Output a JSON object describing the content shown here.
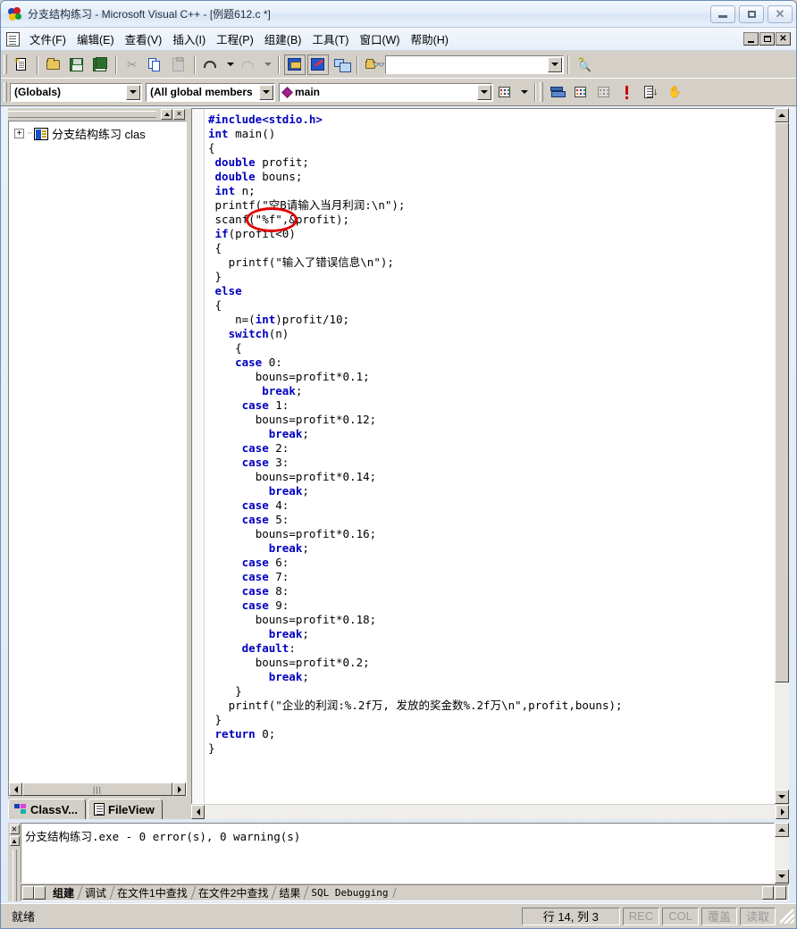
{
  "window": {
    "title": "分支结构练习 - Microsoft Visual C++ - [例题612.c *]",
    "minimize_label": "最小化",
    "maximize_label": "最大化",
    "close_label": "关闭"
  },
  "menu": {
    "items": [
      "文件(F)",
      "编辑(E)",
      "查看(V)",
      "插入(I)",
      "工程(P)",
      "组建(B)",
      "工具(T)",
      "窗口(W)",
      "帮助(H)"
    ],
    "mdi_minimize": "_",
    "mdi_restore": "",
    "mdi_close": "X"
  },
  "toolbar_standard": {
    "buttons": [
      {
        "name": "new-file",
        "icon": "new-document-icon"
      },
      {
        "name": "open-file",
        "icon": "open-folder-icon"
      },
      {
        "name": "save-file",
        "icon": "save-disk-icon"
      },
      {
        "name": "save-all",
        "icon": "save-all-disks-icon"
      },
      {
        "name": "cut",
        "icon": "scissors-icon"
      },
      {
        "name": "copy",
        "icon": "copy-icon"
      },
      {
        "name": "paste",
        "icon": "paste-clipboard-icon"
      },
      {
        "name": "undo",
        "icon": "undo-arrow-icon"
      },
      {
        "name": "redo",
        "icon": "redo-arrow-icon"
      },
      {
        "name": "workspace",
        "icon": "workspace-window-icon"
      },
      {
        "name": "output",
        "icon": "output-window-icon"
      },
      {
        "name": "window-list",
        "icon": "window-switch-icon"
      },
      {
        "name": "find-in-files",
        "icon": "find-in-files-icon"
      },
      {
        "name": "search-help",
        "icon": "search-help-icon"
      }
    ],
    "find_box_value": "",
    "find_box_placeholder": ""
  },
  "toolbar_wizardbar": {
    "class_combo": "(Globals)",
    "members_combo": "(All global members",
    "function_combo": "main",
    "buttons": [
      {
        "name": "wizard-action",
        "icon": "wizard-magnifier-icon"
      },
      {
        "name": "compile",
        "icon": "compile-icon"
      },
      {
        "name": "build",
        "icon": "build-grid-icon"
      },
      {
        "name": "stop-build",
        "icon": "stop-build-icon"
      },
      {
        "name": "execute",
        "icon": "execute-exclamation-icon"
      },
      {
        "name": "go",
        "icon": "go-list-icon"
      },
      {
        "name": "insert-breakpoint",
        "icon": "hand-breakpoint-icon"
      }
    ]
  },
  "workspace": {
    "tree_root_label": "分支结构练习 clas",
    "tree_expander": "+",
    "tabs": [
      {
        "label": "ClassV...",
        "icon": "classview-icon",
        "active": true
      },
      {
        "label": "FileView",
        "icon": "fileview-icon",
        "active": false
      }
    ]
  },
  "editor": {
    "code_lines": [
      {
        "indent": 0,
        "parts": [
          {
            "t": "#include<stdio.h>",
            "c": "pp"
          }
        ]
      },
      {
        "indent": 0,
        "parts": [
          {
            "t": "int",
            "c": "kw"
          },
          {
            "t": " main()",
            "c": ""
          }
        ]
      },
      {
        "indent": 0,
        "parts": [
          {
            "t": "{",
            "c": ""
          }
        ]
      },
      {
        "indent": 1,
        "parts": [
          {
            "t": "double",
            "c": "kw"
          },
          {
            "t": " profit;",
            "c": ""
          }
        ]
      },
      {
        "indent": 1,
        "parts": [
          {
            "t": "double",
            "c": "kw"
          },
          {
            "t": " bouns;",
            "c": ""
          }
        ]
      },
      {
        "indent": 1,
        "parts": [
          {
            "t": "int",
            "c": "kw"
          },
          {
            "t": " n;",
            "c": ""
          }
        ]
      },
      {
        "indent": 1,
        "parts": [
          {
            "t": "printf(\"空B请输入当月利润:\\n\");",
            "c": ""
          }
        ]
      },
      {
        "indent": 1,
        "parts": [
          {
            "t": "scanf(\"%f\",&profit);",
            "c": ""
          }
        ]
      },
      {
        "indent": 1,
        "parts": [
          {
            "t": "if",
            "c": "kw"
          },
          {
            "t": "(profit<0)",
            "c": ""
          }
        ]
      },
      {
        "indent": 1,
        "parts": [
          {
            "t": "{",
            "c": ""
          }
        ]
      },
      {
        "indent": 3,
        "parts": [
          {
            "t": "printf(\"输入了错误信息\\n\");",
            "c": ""
          }
        ]
      },
      {
        "indent": 1,
        "parts": [
          {
            "t": "}",
            "c": ""
          }
        ]
      },
      {
        "indent": 1,
        "parts": [
          {
            "t": "else",
            "c": "kw"
          }
        ]
      },
      {
        "indent": 1,
        "parts": [
          {
            "t": "{",
            "c": ""
          }
        ]
      },
      {
        "indent": 4,
        "parts": [
          {
            "t": "n=(",
            "c": ""
          },
          {
            "t": "int",
            "c": "kw"
          },
          {
            "t": ")profit/10;",
            "c": ""
          }
        ]
      },
      {
        "indent": 3,
        "parts": [
          {
            "t": "switch",
            "c": "kw"
          },
          {
            "t": "(n)",
            "c": ""
          }
        ]
      },
      {
        "indent": 4,
        "parts": [
          {
            "t": "{",
            "c": ""
          }
        ]
      },
      {
        "indent": 4,
        "parts": [
          {
            "t": "case",
            "c": "kw"
          },
          {
            "t": " 0:",
            "c": ""
          }
        ]
      },
      {
        "indent": 7,
        "parts": [
          {
            "t": "bouns=profit*0.1;",
            "c": ""
          }
        ]
      },
      {
        "indent": 8,
        "parts": [
          {
            "t": "break",
            "c": "kw"
          },
          {
            "t": ";",
            "c": ""
          }
        ]
      },
      {
        "indent": 5,
        "parts": [
          {
            "t": "case",
            "c": "kw"
          },
          {
            "t": " 1:",
            "c": ""
          }
        ]
      },
      {
        "indent": 7,
        "parts": [
          {
            "t": "bouns=profit*0.12;",
            "c": ""
          }
        ]
      },
      {
        "indent": 9,
        "parts": [
          {
            "t": "break",
            "c": "kw"
          },
          {
            "t": ";",
            "c": ""
          }
        ]
      },
      {
        "indent": 5,
        "parts": [
          {
            "t": "case",
            "c": "kw"
          },
          {
            "t": " 2:",
            "c": ""
          }
        ]
      },
      {
        "indent": 5,
        "parts": [
          {
            "t": "case",
            "c": "kw"
          },
          {
            "t": " 3:",
            "c": ""
          }
        ]
      },
      {
        "indent": 7,
        "parts": [
          {
            "t": "bouns=profit*0.14;",
            "c": ""
          }
        ]
      },
      {
        "indent": 9,
        "parts": [
          {
            "t": "break",
            "c": "kw"
          },
          {
            "t": ";",
            "c": ""
          }
        ]
      },
      {
        "indent": 5,
        "parts": [
          {
            "t": "case",
            "c": "kw"
          },
          {
            "t": " 4:",
            "c": ""
          }
        ]
      },
      {
        "indent": 5,
        "parts": [
          {
            "t": "case",
            "c": "kw"
          },
          {
            "t": " 5:",
            "c": ""
          }
        ]
      },
      {
        "indent": 7,
        "parts": [
          {
            "t": "bouns=profit*0.16;",
            "c": ""
          }
        ]
      },
      {
        "indent": 9,
        "parts": [
          {
            "t": "break",
            "c": "kw"
          },
          {
            "t": ";",
            "c": ""
          }
        ]
      },
      {
        "indent": 5,
        "parts": [
          {
            "t": "case",
            "c": "kw"
          },
          {
            "t": " 6:",
            "c": ""
          }
        ]
      },
      {
        "indent": 5,
        "parts": [
          {
            "t": "case",
            "c": "kw"
          },
          {
            "t": " 7:",
            "c": ""
          }
        ]
      },
      {
        "indent": 5,
        "parts": [
          {
            "t": "case",
            "c": "kw"
          },
          {
            "t": " 8:",
            "c": ""
          }
        ]
      },
      {
        "indent": 5,
        "parts": [
          {
            "t": "case",
            "c": "kw"
          },
          {
            "t": " 9:",
            "c": ""
          }
        ]
      },
      {
        "indent": 7,
        "parts": [
          {
            "t": "bouns=profit*0.18;",
            "c": ""
          }
        ]
      },
      {
        "indent": 9,
        "parts": [
          {
            "t": "break",
            "c": "kw"
          },
          {
            "t": ";",
            "c": ""
          }
        ]
      },
      {
        "indent": 5,
        "parts": [
          {
            "t": "default",
            "c": "kw"
          },
          {
            "t": ":",
            "c": ""
          }
        ]
      },
      {
        "indent": 7,
        "parts": [
          {
            "t": "bouns=profit*0.2;",
            "c": ""
          }
        ]
      },
      {
        "indent": 9,
        "parts": [
          {
            "t": "break",
            "c": "kw"
          },
          {
            "t": ";",
            "c": ""
          }
        ]
      },
      {
        "indent": 4,
        "parts": [
          {
            "t": "}",
            "c": ""
          }
        ]
      },
      {
        "indent": 3,
        "parts": [
          {
            "t": "printf(\"企业的利润:%.2f万, 发放的奖金数%.2f万\\n\",profit,bouns);",
            "c": ""
          }
        ]
      },
      {
        "indent": 1,
        "parts": [
          {
            "t": "}",
            "c": ""
          }
        ]
      },
      {
        "indent": 1,
        "parts": [
          {
            "t": "return",
            "c": "kw"
          },
          {
            "t": " 0;",
            "c": ""
          }
        ]
      },
      {
        "indent": 0,
        "parts": [
          {
            "t": "}",
            "c": ""
          }
        ]
      }
    ],
    "annotation": {
      "shape": "ellipse",
      "color": "#e00000",
      "encircles": "\"%f\""
    }
  },
  "output": {
    "lines": [
      "分支结构练习.exe - 0 error(s), 0 warning(s)"
    ],
    "tabs": [
      {
        "label": "组建",
        "active": true
      },
      {
        "label": "调试",
        "active": false
      },
      {
        "label": "在文件1中查找",
        "active": false
      },
      {
        "label": "在文件2中查找",
        "active": false
      },
      {
        "label": "结果",
        "active": false
      },
      {
        "label": "SQL Debugging",
        "active": false
      }
    ]
  },
  "statusbar": {
    "message": "就绪",
    "position": "行 14, 列 3",
    "indicators": [
      "REC",
      "COL",
      "覆盖",
      "读取"
    ]
  },
  "colors": {
    "keyword": "#0000c0",
    "annotation": "#e00000",
    "chrome": "#d4d0c8",
    "titlebar": "#e4edf9"
  }
}
